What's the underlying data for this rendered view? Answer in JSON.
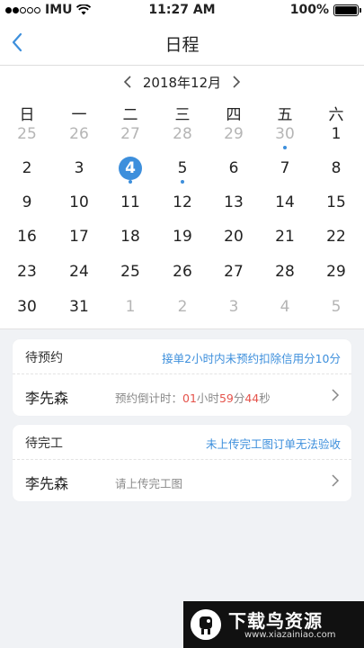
{
  "status_bar": {
    "carrier": "IMU",
    "time": "11:27 AM",
    "battery": "100%",
    "battery_level": 1.0
  },
  "nav": {
    "title": "日程",
    "back_icon": "chevron-left-icon"
  },
  "calendar": {
    "month_label": "2018年12月",
    "weekdays": [
      "日",
      "一",
      "二",
      "三",
      "四",
      "五",
      "六"
    ],
    "weeks": [
      [
        {
          "d": "25",
          "other": true
        },
        {
          "d": "26",
          "other": true
        },
        {
          "d": "27",
          "other": true
        },
        {
          "d": "28",
          "other": true
        },
        {
          "d": "29",
          "other": true
        },
        {
          "d": "30",
          "other": true,
          "event": true
        },
        {
          "d": "1"
        }
      ],
      [
        {
          "d": "2"
        },
        {
          "d": "3"
        },
        {
          "d": "4",
          "selected": true,
          "event": true
        },
        {
          "d": "5",
          "event": true
        },
        {
          "d": "6"
        },
        {
          "d": "7"
        },
        {
          "d": "8"
        }
      ],
      [
        {
          "d": "9"
        },
        {
          "d": "10"
        },
        {
          "d": "11"
        },
        {
          "d": "12"
        },
        {
          "d": "13"
        },
        {
          "d": "14"
        },
        {
          "d": "15"
        }
      ],
      [
        {
          "d": "16"
        },
        {
          "d": "17"
        },
        {
          "d": "18"
        },
        {
          "d": "19"
        },
        {
          "d": "20"
        },
        {
          "d": "21"
        },
        {
          "d": "22"
        }
      ],
      [
        {
          "d": "23"
        },
        {
          "d": "24"
        },
        {
          "d": "25"
        },
        {
          "d": "26"
        },
        {
          "d": "27"
        },
        {
          "d": "28"
        },
        {
          "d": "29"
        }
      ],
      [
        {
          "d": "30"
        },
        {
          "d": "31"
        },
        {
          "d": "1",
          "other": true
        },
        {
          "d": "2",
          "other": true
        },
        {
          "d": "3",
          "other": true
        },
        {
          "d": "4",
          "other": true
        },
        {
          "d": "5",
          "other": true
        }
      ]
    ]
  },
  "pending_reservation": {
    "label": "待预约",
    "note": "接单2小时内未预约扣除信用分10分",
    "name": "李先森",
    "countdown_prefix": "预约倒计时：",
    "hours": "01",
    "hours_unit": "小时",
    "minutes": "59",
    "minutes_unit": "分",
    "seconds": "44",
    "seconds_unit": "秒"
  },
  "pending_completion": {
    "label": "待完工",
    "note": "未上传完工图订单无法验收",
    "name": "李先森",
    "info": "请上传完工图"
  },
  "watermark": {
    "title": "下载鸟资源",
    "url": "www.xiazainiao.com"
  },
  "colors": {
    "accent": "#3d8fdc",
    "countdown": "#e5534b",
    "background": "#f0f2f5"
  }
}
